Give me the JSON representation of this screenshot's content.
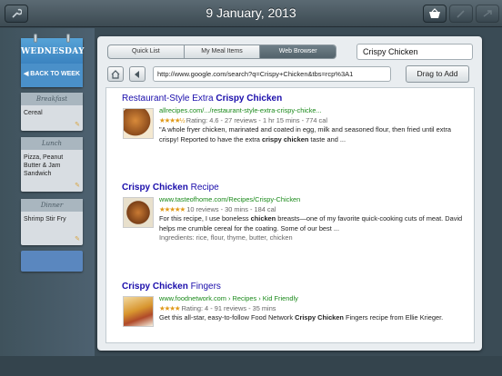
{
  "header": {
    "title": "9 January, 2013"
  },
  "sidebar": {
    "calendar_day": "WEDNESDAY",
    "back_label": "BACK TO WEEK",
    "meals": [
      {
        "heading": "Breakfast",
        "item": "Cereal"
      },
      {
        "heading": "Lunch",
        "item": "Pizza, Peanut Butter & Jam Sandwich"
      },
      {
        "heading": "Dinner",
        "item": "Shrimp Stir Fry"
      }
    ]
  },
  "tabs": [
    {
      "label": "Quick List"
    },
    {
      "label": "My Meal Items"
    },
    {
      "label": "Web Browser"
    }
  ],
  "search": {
    "value": "Crispy Chicken"
  },
  "browser": {
    "url": "http://www.google.com/search?q=Crispy+Chicken&tbs=rcp%3A1",
    "drag_label": "Drag to Add"
  },
  "results": [
    {
      "title_prefix": "Restaurant-Style Extra ",
      "title_bold": "Crispy Chicken",
      "title_suffix": "",
      "url": "allrecipes.com/.../restaurant-style-extra-crispy-chicke...",
      "stars": "★★★★½",
      "rating": "Rating: 4.6 - 27 reviews - 1 hr 15 mins - 774 cal",
      "snippet_a": "\"A whole fryer chicken, marinated and coated in egg, milk and seasoned flour, then fried until extra crispy! Reported to have the extra ",
      "snippet_bold": "crispy chicken",
      "snippet_b": " taste and ..."
    },
    {
      "title_prefix": "",
      "title_bold": "Crispy Chicken",
      "title_suffix": " Recipe",
      "url": "www.tasteofhome.com/Recipes/Crispy-Chicken",
      "stars": "★★★★★",
      "rating": "10 reviews - 30 mins - 184 cal",
      "snippet_a": "For this recipe, I use boneless ",
      "snippet_bold": "chicken",
      "snippet_b": " breasts—one of my favorite quick-cooking cuts of meat. David helps me crumble cereal for the coating. Some of our best ...",
      "ingredients": "Ingredients: rice, flour, thyme, butter, chicken"
    },
    {
      "title_prefix": "",
      "title_bold": "Crispy Chicken",
      "title_suffix": " Fingers",
      "url": "www.foodnetwork.com › Recipes › Kid Friendly",
      "stars": "★★★★",
      "rating": "Rating: 4 - 91 reviews - 35 mins",
      "snippet_a": "Get this all-star, easy-to-follow Food Network ",
      "snippet_bold": "Crispy Chicken",
      "snippet_b": " Fingers recipe from Ellie Krieger."
    }
  ],
  "icons": {
    "wrench": "wrench-icon",
    "basket": "basket-icon",
    "home": "home-icon",
    "back": "back-arrow-icon"
  }
}
